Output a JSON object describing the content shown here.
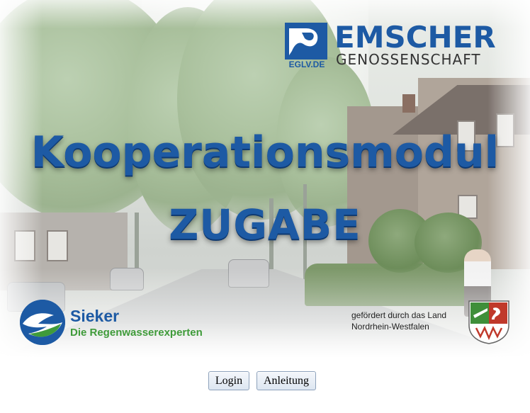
{
  "hero": {
    "title_line1": "Kooperationsmodul",
    "title_line2": "ZUGABE"
  },
  "logos": {
    "emscher": {
      "name": "EMSCHER",
      "subtitle": "GENOSSENSCHAFT",
      "mark_text": "EGLV.DE"
    },
    "sieker": {
      "name": "Sieker",
      "tagline": "Die Regenwasserexperten"
    },
    "nrw": {
      "line1": "gefördert durch das Land",
      "line2": "Nordrhein-Westfalen"
    }
  },
  "buttons": {
    "login": "Login",
    "guide": "Anleitung"
  },
  "colors": {
    "brand_blue": "#1d5aa4",
    "sieker_green": "#3f9b3a",
    "nrw_red": "#c0392b"
  },
  "icons": {
    "emscher": "emscher-logo-icon",
    "sieker": "sieker-logo-icon",
    "nrw": "nrw-crest-icon"
  }
}
